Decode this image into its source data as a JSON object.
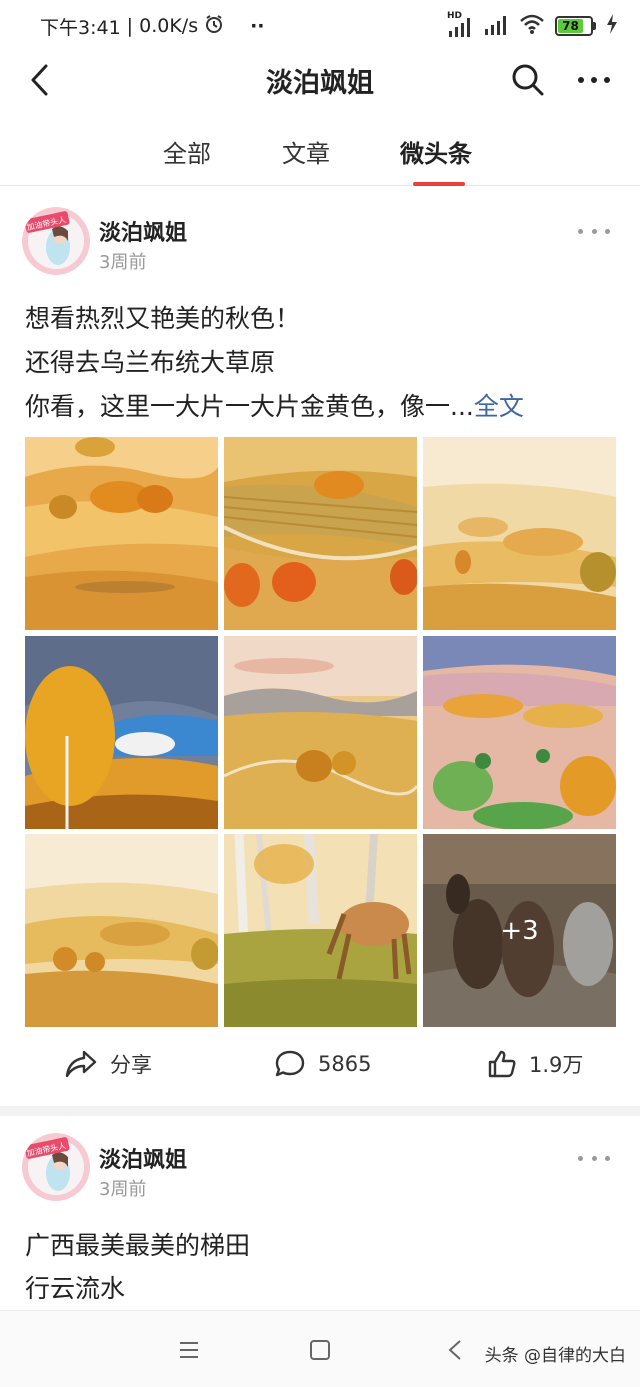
{
  "status_bar": {
    "time": "下午3:41",
    "network_speed": "| 0.0K/s",
    "network_badge": "HD",
    "battery_level": "78"
  },
  "title_bar": {
    "title": "淡泊飒姐"
  },
  "tabs": [
    {
      "label": "全部",
      "active": false
    },
    {
      "label": "文章",
      "active": false
    },
    {
      "label": "微头条",
      "active": true
    }
  ],
  "posts": [
    {
      "author": "淡泊飒姐",
      "time": "3周前",
      "lines": [
        "想看热烈又艳美的秋色！",
        "还得去乌兰布统大草原",
        "你看，这里一大片一大片金黄色，像一..."
      ],
      "read_more": "全文",
      "more_images": "+3",
      "share_label": "分享",
      "comment_count": "5865",
      "like_count": "1.9万"
    },
    {
      "author": "淡泊飒姐",
      "time": "3周前",
      "lines": [
        "广西最美最美的梯田",
        "行云流水"
      ]
    }
  ],
  "avatar_badge": "加油带头人",
  "watermark": "头条 @自律的大白",
  "colors": {
    "accent": "#e8433b",
    "link": "#3b67a4",
    "battery": "#5bcb3a"
  }
}
